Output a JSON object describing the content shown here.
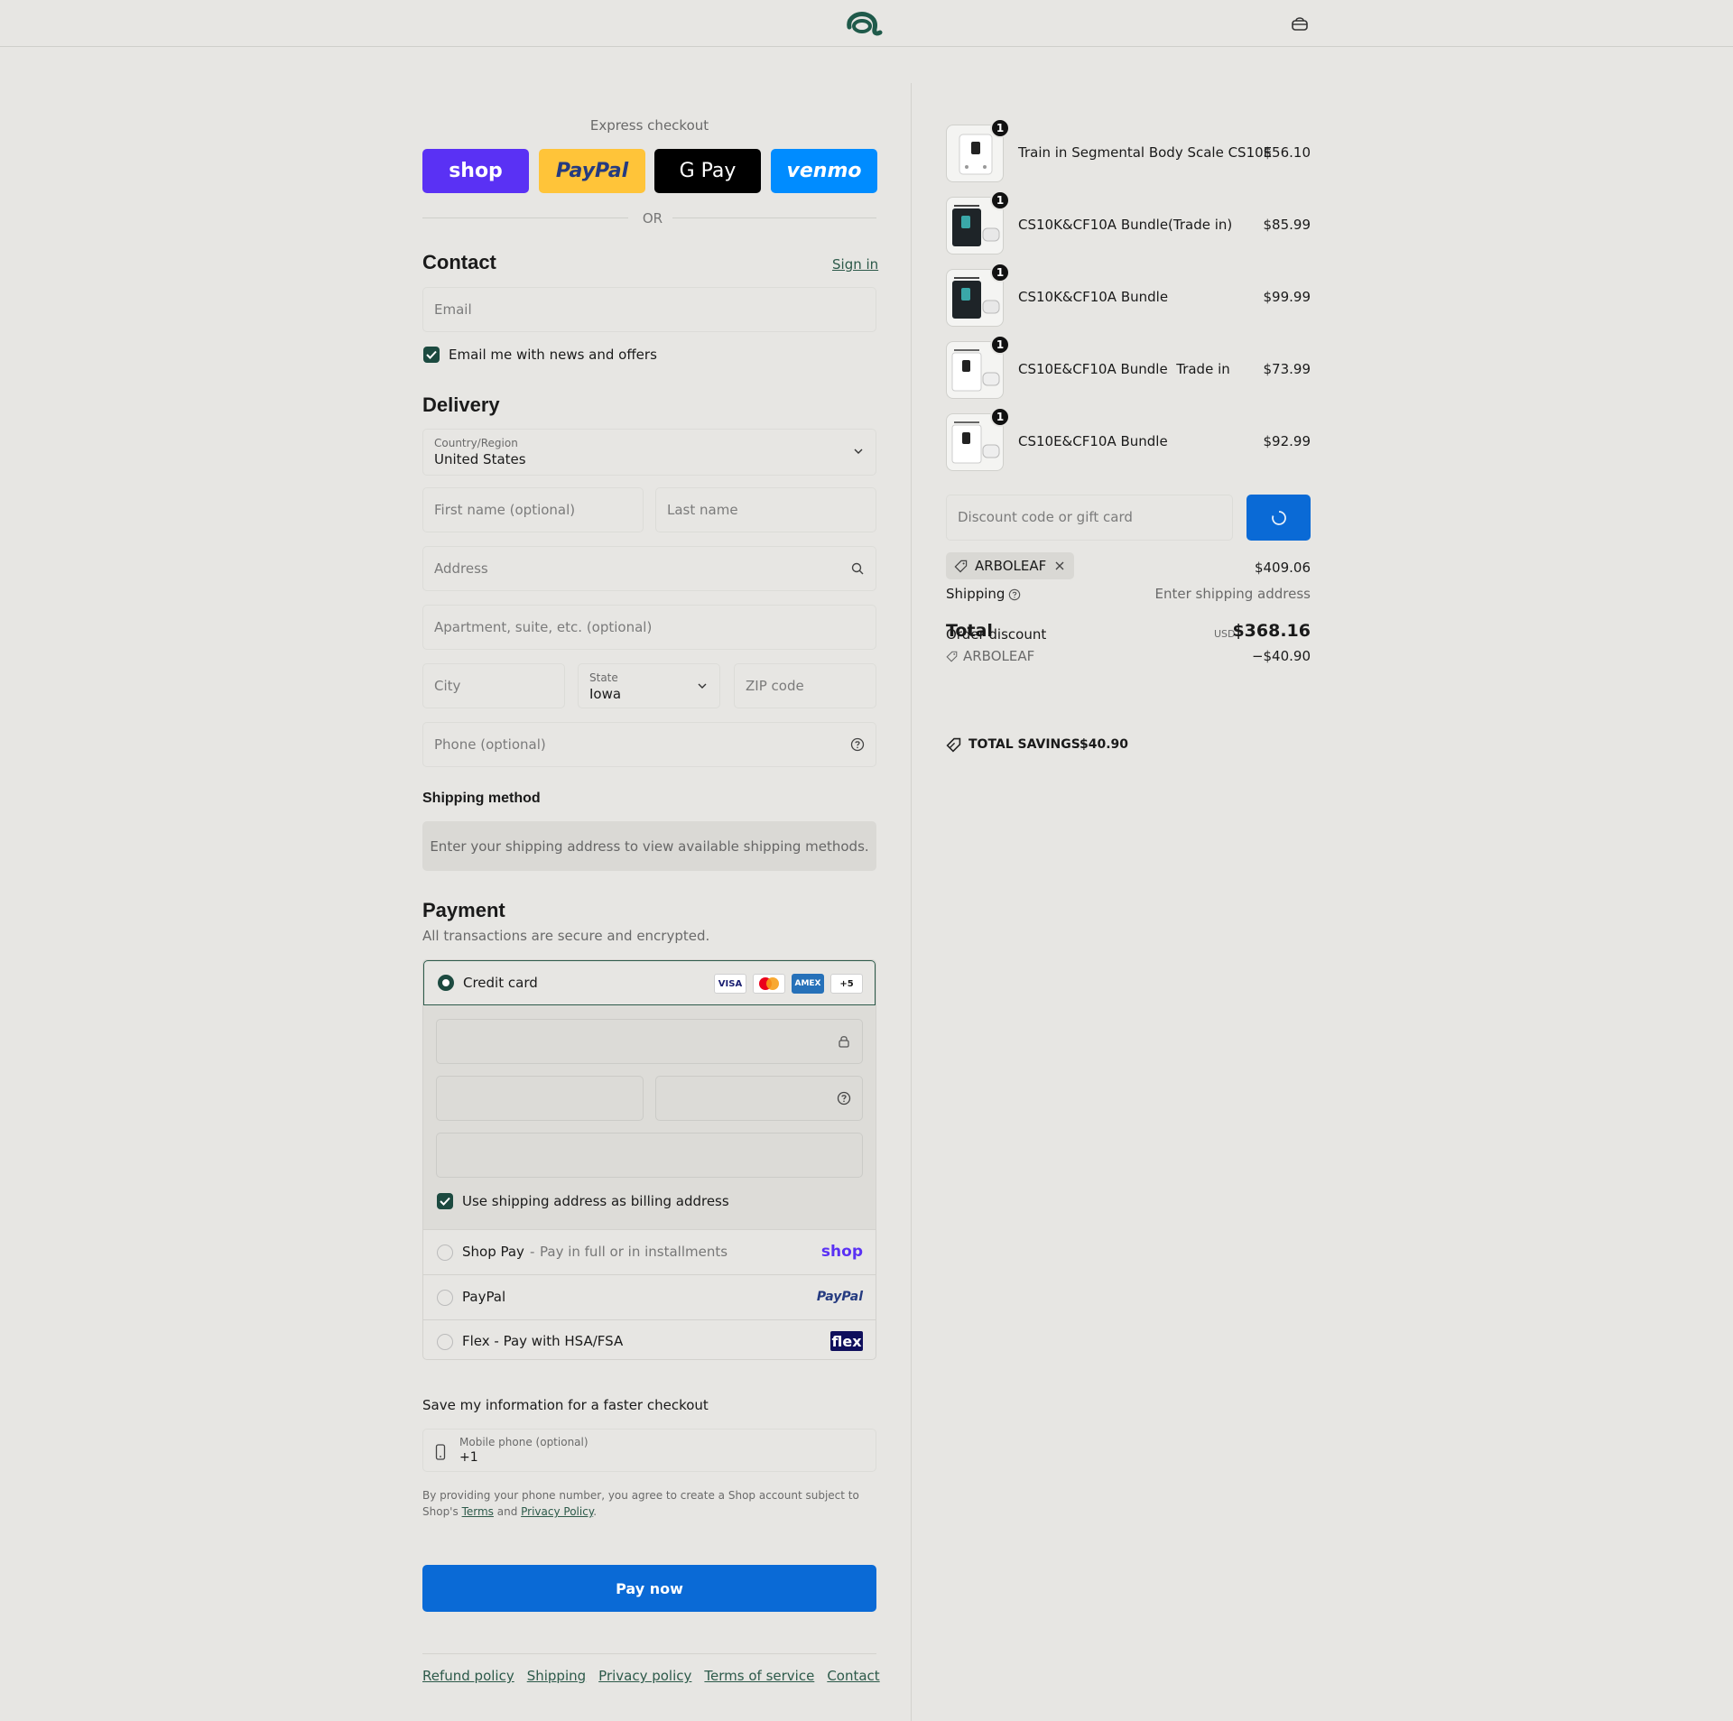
{
  "header": {
    "logo_icon": "arboleaf-logo-icon",
    "bag_icon": "shopping-bag-icon"
  },
  "express": {
    "title": "Express checkout",
    "buttons": [
      {
        "label": "shop",
        "color": "#5a31f4"
      },
      {
        "label": "PayPal",
        "color": "#ffc439"
      },
      {
        "label": "G Pay",
        "color": "#000000"
      },
      {
        "label": "venmo",
        "color": "#008cff"
      }
    ],
    "or": "OR"
  },
  "contact": {
    "title": "Contact",
    "sign_in": "Sign in",
    "email_placeholder": "Email",
    "news_checkbox": "Email me with news and offers",
    "news_checked": true
  },
  "delivery": {
    "title": "Delivery",
    "country_label": "Country/Region",
    "country_value": "United States",
    "first_name_placeholder": "First name (optional)",
    "last_name_placeholder": "Last name",
    "address_placeholder": "Address",
    "apartment_placeholder": "Apartment, suite, etc. (optional)",
    "city_placeholder": "City",
    "state_label": "State",
    "state_value": "Iowa",
    "zip_placeholder": "ZIP code",
    "phone_placeholder": "Phone (optional)"
  },
  "shipping_method": {
    "title": "Shipping method",
    "notice": "Enter your shipping address to view available shipping methods."
  },
  "payment": {
    "title": "Payment",
    "subtitle": "All transactions are secure and encrypted.",
    "credit_card_label": "Credit card",
    "card_logos": [
      "VISA",
      "mastercard",
      "AMEX",
      "+5"
    ],
    "billing_checkbox": "Use shipping address as billing address",
    "billing_checked": true,
    "shop_pay_label": "Shop Pay",
    "shop_pay_sub": "Pay in full or in installments",
    "shop_pay_logo": "shop",
    "paypal_label": "PayPal",
    "paypal_logo": "PayPal",
    "flex_label": "Flex - Pay with HSA/FSA",
    "flex_logo": "flex",
    "accent_color": "#1c4a40"
  },
  "save_info": {
    "title": "Save my information for a faster checkout",
    "phone_label": "Mobile phone (optional)",
    "phone_value": "+1",
    "note_part1": "By providing your phone number, you agree to create a Shop account subject to Shop's",
    "terms": "Terms",
    "and": "and",
    "privacy": "Privacy Policy",
    "period": "."
  },
  "pay_now": "Pay now",
  "footer_links": [
    "Refund policy",
    "Shipping",
    "Privacy policy",
    "Terms of service",
    "Contact"
  ],
  "order": {
    "items": [
      {
        "qty": "1",
        "name": "Train in Segmental Body Scale CS10E",
        "price": "$56.10",
        "thumb": "white-scale"
      },
      {
        "qty": "1",
        "name": "CS10K&CF10A Bundle(Trade in)",
        "price": "$85.99",
        "thumb": "black-bundle"
      },
      {
        "qty": "1",
        "name": "CS10K&CF10A Bundle",
        "price": "$99.99",
        "thumb": "black-bundle"
      },
      {
        "qty": "1",
        "name": "CS10E&CF10A Bundle  Trade in",
        "price": "$73.99",
        "thumb": "white-bundle"
      },
      {
        "qty": "1",
        "name": "CS10E&CF10A Bundle",
        "price": "$92.99",
        "thumb": "white-bundle"
      }
    ],
    "discount_placeholder": "Discount code or gift card",
    "code_tag": "ARBOLEAF",
    "subtotal": "$409.06",
    "shipping_label": "Shipping",
    "shipping_value": "Enter shipping address",
    "order_discount_label": "Order discount",
    "order_discount_code": "ARBOLEAF",
    "order_discount_value": "−$40.90",
    "total_label": "Total",
    "currency": "USD",
    "total_value": "$368.16",
    "savings_label": "TOTAL SAVINGS",
    "savings_value": "$40.90",
    "button_color": "#0a6ad6"
  }
}
